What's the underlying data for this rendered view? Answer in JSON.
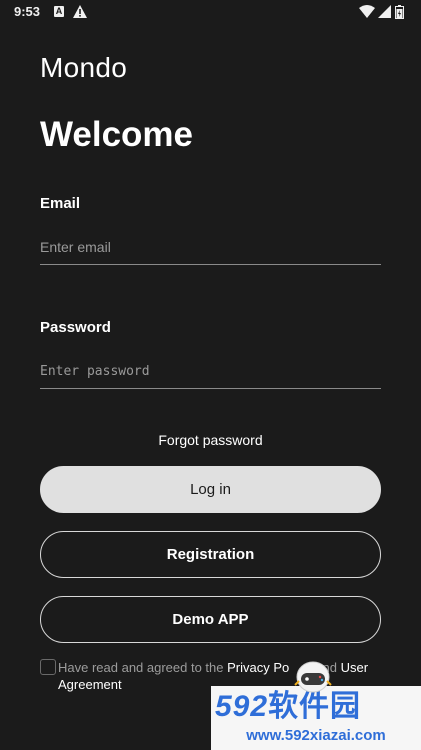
{
  "status_bar": {
    "time": "9:53",
    "icons": [
      "a-notification-icon",
      "warning-icon",
      "wifi-icon",
      "signal-icon",
      "battery-icon"
    ]
  },
  "app": {
    "title": "Mondo",
    "welcome": "Welcome"
  },
  "form": {
    "email_label": "Email",
    "email_placeholder": "Enter email",
    "email_value": "",
    "password_label": "Password",
    "password_placeholder": "Enter password",
    "password_value": "",
    "forgot_password": "Forgot password",
    "login_button": "Log in",
    "registration_button": "Registration",
    "demo_button": "Demo APP",
    "agreement": {
      "prefix": "Have read and agreed to the ",
      "privacy_link": "Privacy Po",
      "middle": "and ",
      "user_link": "User",
      "suffix": "Agreement",
      "checked": false
    }
  },
  "watermark": {
    "logo_number": "592",
    "logo_text": "软件园",
    "url": "www.592xiazai.com"
  },
  "colors": {
    "background": "#1b1b1b",
    "primary_button": "#e0e0e0",
    "text": "#ffffff",
    "muted_text": "#9c9c9c",
    "watermark_blue": "#2f6ed8"
  }
}
